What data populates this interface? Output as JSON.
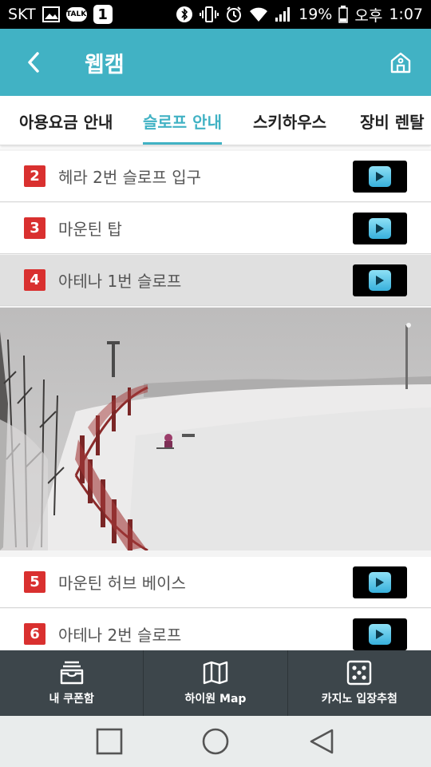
{
  "status_bar": {
    "carrier": "SKT",
    "talk_label": "TALK",
    "badge_count": "1",
    "battery": "19%",
    "ampm": "오후",
    "time": "1:07"
  },
  "header": {
    "title": "웹캠",
    "background_color": "#41b2c4"
  },
  "tabs": [
    {
      "label": "아용요금 안내",
      "active": false
    },
    {
      "label": "슬로프 안내",
      "active": true
    },
    {
      "label": "스키하우스",
      "active": false
    },
    {
      "label": "장비 렌탈",
      "active": false
    }
  ],
  "webcams": [
    {
      "number": "2",
      "label": "헤라 2번 슬로프 입구",
      "selected": false
    },
    {
      "number": "3",
      "label": "마운틴 탑",
      "selected": false
    },
    {
      "number": "4",
      "label": "아테나 1번 슬로프",
      "selected": true
    },
    {
      "number": "5",
      "label": "마운틴 허브 베이스",
      "selected": false
    },
    {
      "number": "6",
      "label": "아테나 2번 슬로프",
      "selected": false
    }
  ],
  "bottom_nav": [
    {
      "label": "내 쿠폰함",
      "icon": "coupon-tray-icon"
    },
    {
      "label": "하이원 Map",
      "icon": "map-icon"
    },
    {
      "label": "카지노 입장추첨",
      "icon": "dice-icon"
    }
  ],
  "system_nav": [
    "recent-apps-icon",
    "home-circle-icon",
    "back-triangle-icon"
  ],
  "colors": {
    "accent": "#41b2c4",
    "badge_red": "#d9302f",
    "bottom_nav_bg": "#3d464b"
  }
}
